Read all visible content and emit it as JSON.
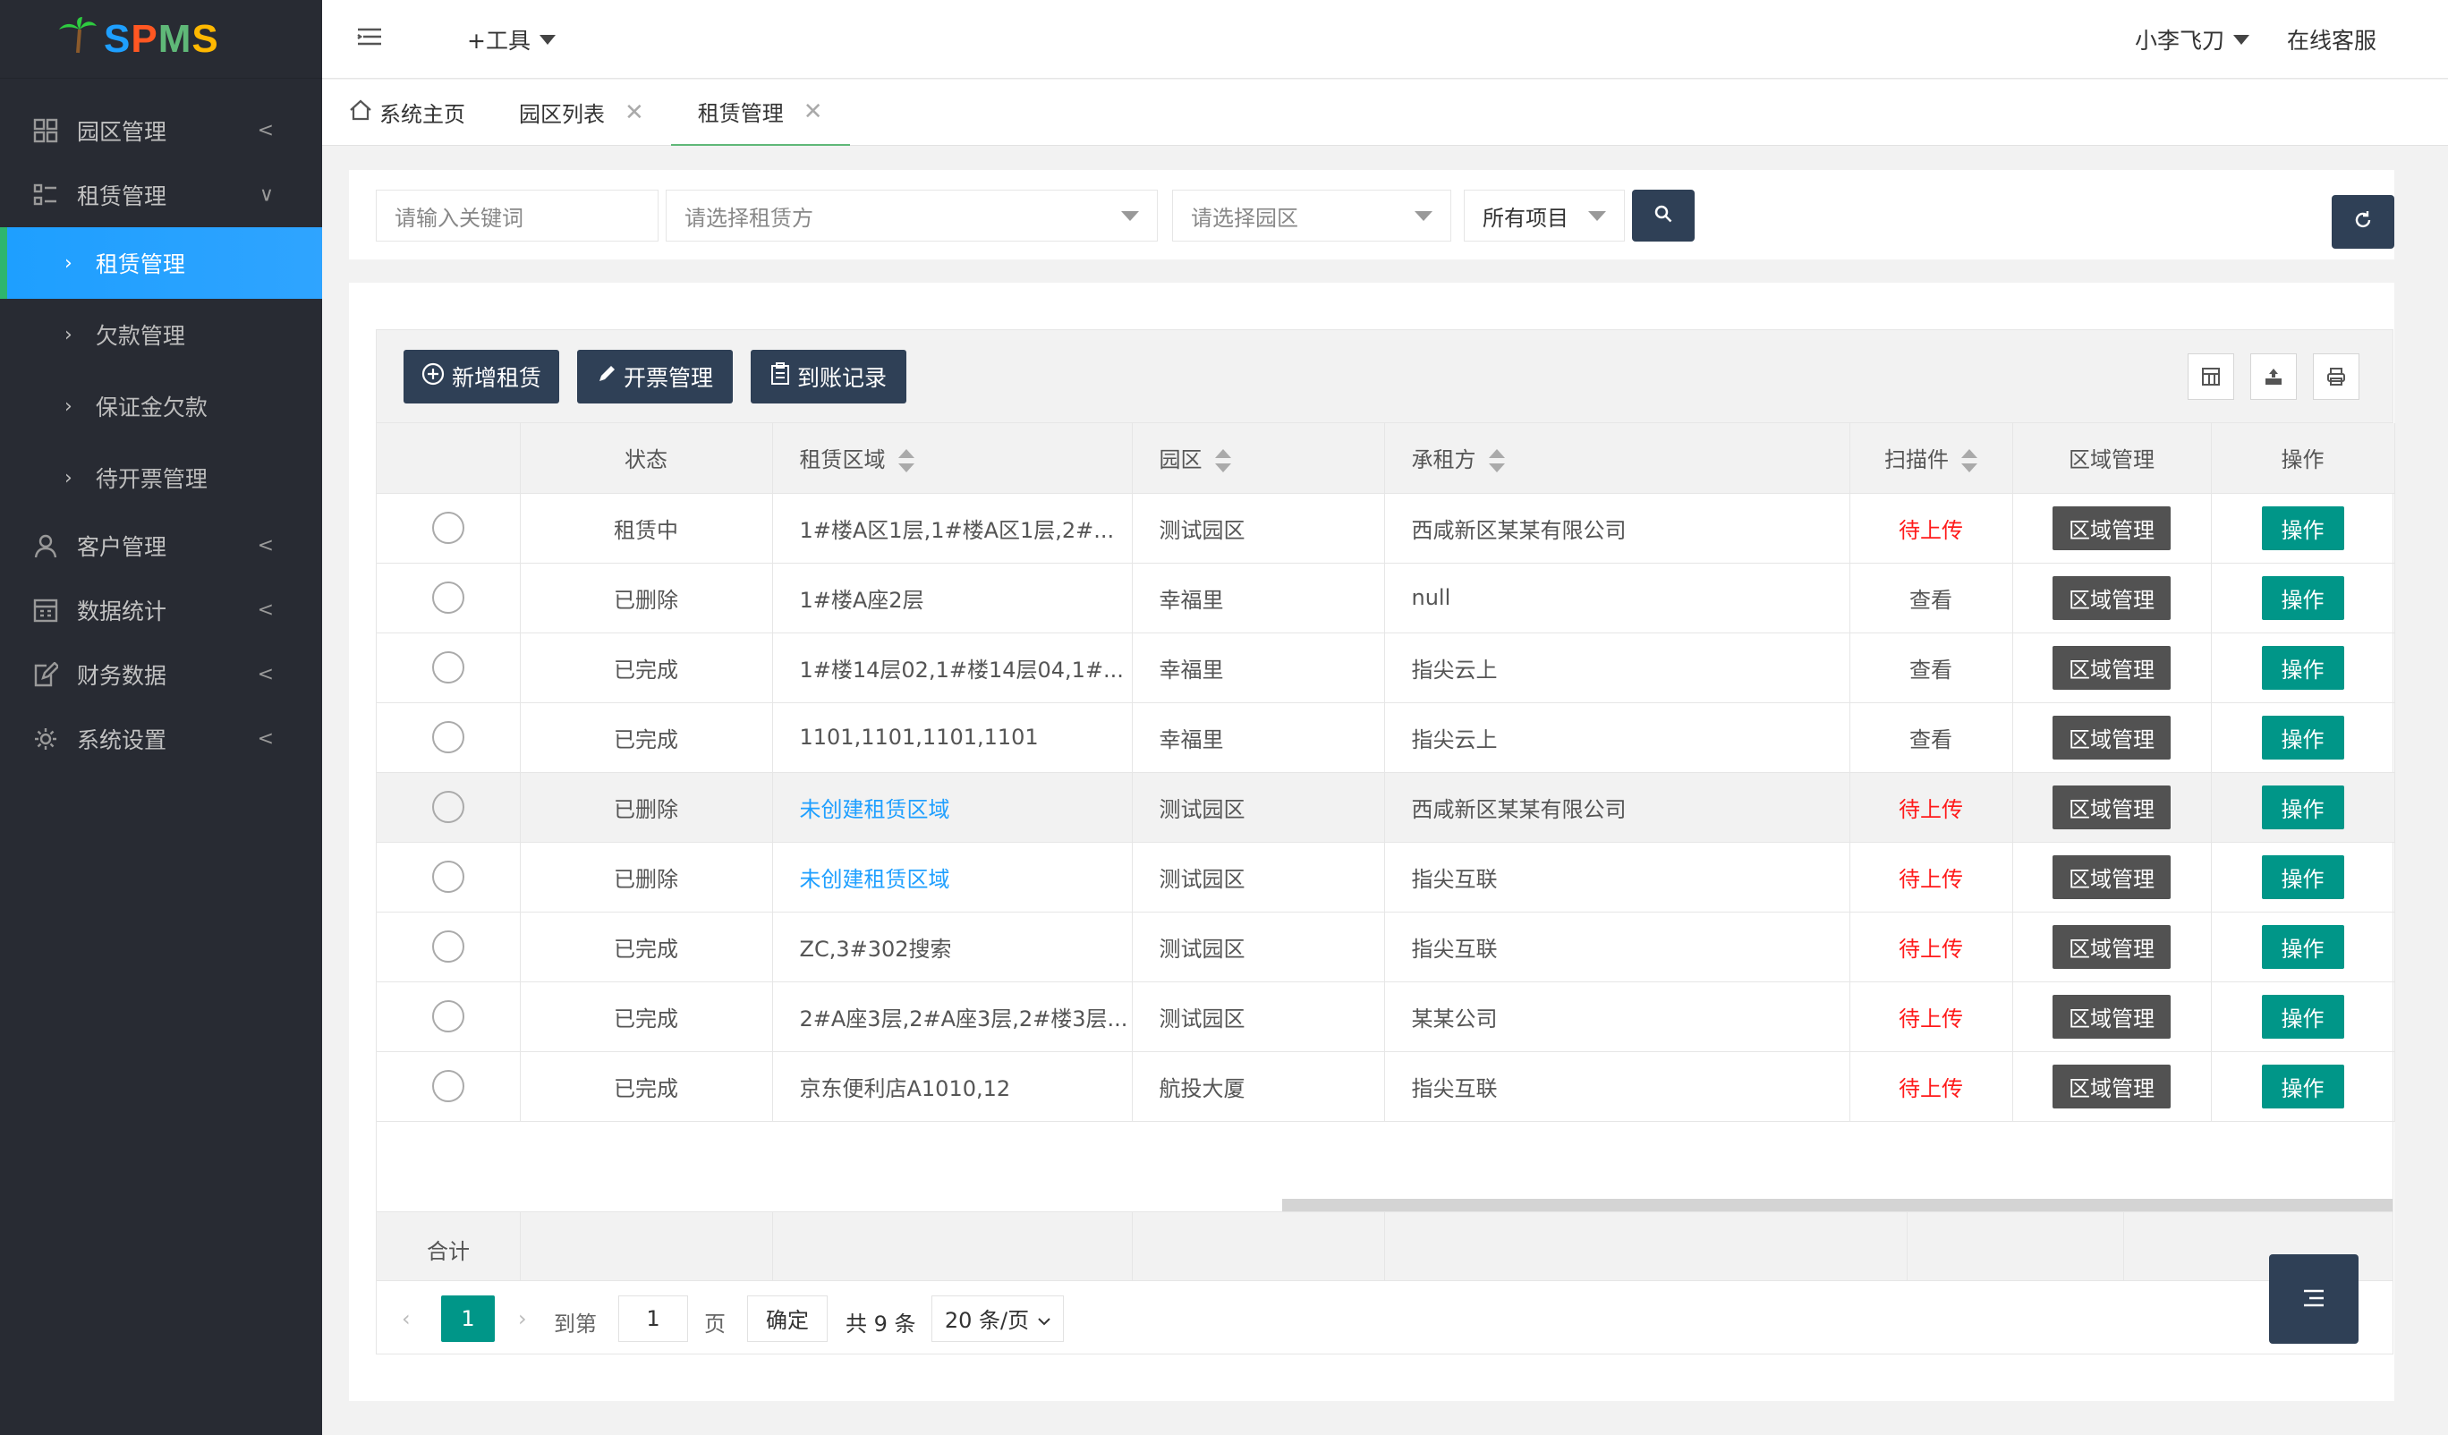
{
  "logo": {
    "icon": "palm-tree-icon",
    "brand_letters": [
      "S",
      "P",
      "M",
      "S"
    ]
  },
  "sidebar": {
    "items": [
      {
        "label": "园区管理",
        "icon": "grid-icon",
        "arrow": "<"
      },
      {
        "label": "租赁管理",
        "icon": "list-icon",
        "arrow": "∨"
      },
      {
        "label": "客户管理",
        "icon": "user-icon",
        "arrow": "<"
      },
      {
        "label": "数据统计",
        "icon": "calendar-icon",
        "arrow": "<"
      },
      {
        "label": "财务数据",
        "icon": "edit-icon",
        "arrow": "<"
      },
      {
        "label": "系统设置",
        "icon": "gear-icon",
        "arrow": "<"
      }
    ],
    "sub_items": [
      {
        "label": "租赁管理",
        "active": true
      },
      {
        "label": "欠款管理"
      },
      {
        "label": "保证金欠款"
      },
      {
        "label": "待开票管理"
      }
    ]
  },
  "topbar": {
    "tools": "+工具",
    "user": "小李飞刀",
    "service": "在线客服"
  },
  "tabs": [
    {
      "label": "系统主页",
      "home": true
    },
    {
      "label": "园区列表",
      "close": "✕"
    },
    {
      "label": "租赁管理",
      "close": "✕",
      "active": true
    }
  ],
  "filter": {
    "keyword_placeholder": "请输入关键词",
    "tenant_placeholder": "请选择租赁方",
    "park_placeholder": "请选择园区",
    "project_value": "所有项目"
  },
  "toolbar": {
    "add": "新增租赁",
    "invoice": "开票管理",
    "receipt": "到账记录"
  },
  "table": {
    "headers": [
      "状态",
      "租赁区域",
      "园区",
      "承租方",
      "扫描件",
      "区域管理",
      "操作"
    ],
    "rows": [
      {
        "status": "租赁中",
        "area": "1#楼A区1层,1#楼A区1层,2#...",
        "park": "测试园区",
        "tenant": "西咸新区某某有限公司",
        "scan": "待上传",
        "zone": "区域管理",
        "op": "操作"
      },
      {
        "status": "已删除",
        "area": "1#楼A座2层",
        "park": "幸福里",
        "tenant": "null",
        "scan": "查看",
        "zone": "区域管理",
        "op": "操作"
      },
      {
        "status": "已完成",
        "area": "1#楼14层02,1#楼14层04,1#...",
        "park": "幸福里",
        "tenant": "指尖云上",
        "scan": "查看",
        "zone": "区域管理",
        "op": "操作"
      },
      {
        "status": "已完成",
        "area": "1101,1101,1101,1101",
        "park": "幸福里",
        "tenant": "指尖云上",
        "scan": "查看",
        "zone": "区域管理",
        "op": "操作"
      },
      {
        "status": "已删除",
        "area": "未创建租赁区域",
        "park": "测试园区",
        "tenant": "西咸新区某某有限公司",
        "scan": "待上传",
        "zone": "区域管理",
        "op": "操作"
      },
      {
        "status": "已删除",
        "area": "未创建租赁区域",
        "park": "测试园区",
        "tenant": "指尖互联",
        "scan": "待上传",
        "zone": "区域管理",
        "op": "操作"
      },
      {
        "status": "已完成",
        "area": "ZC,3#302搜索",
        "park": "测试园区",
        "tenant": "指尖互联",
        "scan": "待上传",
        "zone": "区域管理",
        "op": "操作"
      },
      {
        "status": "已完成",
        "area": "2#A座3层,2#A座3层,2#楼3层...",
        "park": "测试园区",
        "tenant": "某某公司",
        "scan": "待上传",
        "zone": "区域管理",
        "op": "操作"
      },
      {
        "status": "已完成",
        "area": "京东便利店A1010,12",
        "park": "航投大厦",
        "tenant": "指尖互联",
        "scan": "待上传",
        "zone": "区域管理",
        "op": "操作"
      }
    ],
    "total_label": "合计"
  },
  "pager": {
    "current": "1",
    "goto": "到第",
    "page_input": "1",
    "page_unit": "页",
    "confirm": "确定",
    "total": "共 9 条",
    "per_page": "20 条/页"
  },
  "colors": {
    "sidebar": "#282b33",
    "active": "#1e9fff",
    "dark_button": "#2f4056",
    "op_button": "#009688",
    "zone_button": "#525252",
    "pending": "#ff1a1a"
  }
}
